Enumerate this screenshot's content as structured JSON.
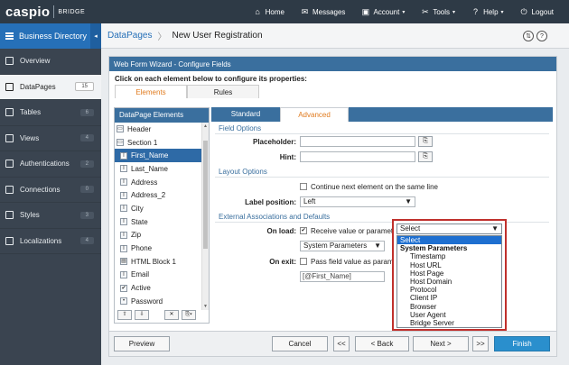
{
  "app": {
    "logo_main": "caspio",
    "logo_sub": "BRIDGE"
  },
  "nav": [
    {
      "label": "Home",
      "icon": "home-icon",
      "glyph": "⌂"
    },
    {
      "label": "Messages",
      "icon": "mail-icon",
      "glyph": "✉"
    },
    {
      "label": "Account",
      "icon": "account-icon",
      "glyph": "▣",
      "caret": "▾"
    },
    {
      "label": "Tools",
      "icon": "tools-icon",
      "glyph": "✂",
      "caret": "▾"
    },
    {
      "label": "Help",
      "icon": "help-icon",
      "glyph": "?",
      "caret": "▾"
    },
    {
      "label": "Logout",
      "icon": "power-icon",
      "glyph": "⏻"
    }
  ],
  "sidebar": {
    "title": "Business Directory",
    "collapse_glyph": "◂",
    "items": [
      {
        "label": "Overview",
        "badge": ""
      },
      {
        "label": "DataPages",
        "badge": "15",
        "active": true
      },
      {
        "label": "Tables",
        "badge": "6"
      },
      {
        "label": "Views",
        "badge": "4"
      },
      {
        "label": "Authentications",
        "badge": "2"
      },
      {
        "label": "Connections",
        "badge": "0"
      },
      {
        "label": "Styles",
        "badge": "3"
      },
      {
        "label": "Localizations",
        "badge": "4"
      }
    ]
  },
  "header": {
    "crumb_link": "DataPages",
    "crumb_sep": "〉",
    "crumb_current": "New User Registration",
    "icon_a": "⇅",
    "icon_b": "?"
  },
  "wizard": {
    "title": "Web Form Wizard - Configure Fields",
    "subtitle": "Click on each element below to configure its properties:",
    "tabs": [
      "Elements",
      "Rules"
    ],
    "elements_header": "DataPage Elements",
    "elements": [
      {
        "label": "Header",
        "glyph": "▭",
        "indent": false
      },
      {
        "label": "Section 1",
        "glyph": "▭",
        "indent": false
      },
      {
        "label": "First_Name",
        "glyph": "I",
        "indent": true,
        "selected": true
      },
      {
        "label": "Last_Name",
        "glyph": "I",
        "indent": true
      },
      {
        "label": "Address",
        "glyph": "I",
        "indent": true
      },
      {
        "label": "Address_2",
        "glyph": "I",
        "indent": true
      },
      {
        "label": "City",
        "glyph": "I",
        "indent": true
      },
      {
        "label": "State",
        "glyph": "I",
        "indent": true
      },
      {
        "label": "Zip",
        "glyph": "I",
        "indent": true
      },
      {
        "label": "Phone",
        "glyph": "I",
        "indent": true
      },
      {
        "label": "HTML Block 1",
        "glyph": "▤",
        "indent": true
      },
      {
        "label": "Email",
        "glyph": "I",
        "indent": true
      },
      {
        "label": "Active",
        "glyph": "✔",
        "indent": true
      },
      {
        "label": "Password",
        "glyph": "•",
        "indent": true
      }
    ],
    "tools": [
      "⇧",
      "⇩",
      "✕",
      "⎘▾"
    ],
    "cfg_tabs": [
      "Standard",
      "Advanced"
    ],
    "sections": {
      "field_options": "Field Options",
      "layout_options": "Layout Options",
      "external": "External Associations and Defaults"
    },
    "placeholder_label": "Placeholder:",
    "hint_label": "Hint:",
    "continue_label": "Continue next element on the same line",
    "label_position_label": "Label position:",
    "label_position_value": "Left",
    "on_load_label": "On load:",
    "on_load_check_label": "Receive value or parameter:",
    "on_load_source": "System Parameters",
    "on_exit_label": "On exit:",
    "on_exit_check_label": "Pass field value as parameter",
    "on_exit_value": "[@First_Name]",
    "check_glyph": "✔",
    "tool_glyph": "⎘"
  },
  "dropdown": {
    "selected": "Select",
    "options": [
      {
        "label": "Select",
        "kind": "first"
      },
      {
        "label": "System Parameters",
        "kind": "group"
      },
      {
        "label": "Timestamp",
        "kind": "opt"
      },
      {
        "label": "Host URL",
        "kind": "opt"
      },
      {
        "label": "Host Page",
        "kind": "opt"
      },
      {
        "label": "Host Domain",
        "kind": "opt"
      },
      {
        "label": "Protocol",
        "kind": "opt"
      },
      {
        "label": "Client IP",
        "kind": "opt"
      },
      {
        "label": "Browser",
        "kind": "opt"
      },
      {
        "label": "User Agent",
        "kind": "opt"
      },
      {
        "label": "Bridge Server",
        "kind": "opt"
      }
    ],
    "caret": "▼"
  },
  "footer": {
    "preview": "Preview",
    "cancel": "Cancel",
    "first": "<<",
    "back": "< Back",
    "next": "Next >",
    "last": ">>",
    "finish": "Finish"
  },
  "colors": {
    "accent": "#2670b8",
    "highlight": "#c0302c",
    "active_tab": "#e07b1f"
  }
}
